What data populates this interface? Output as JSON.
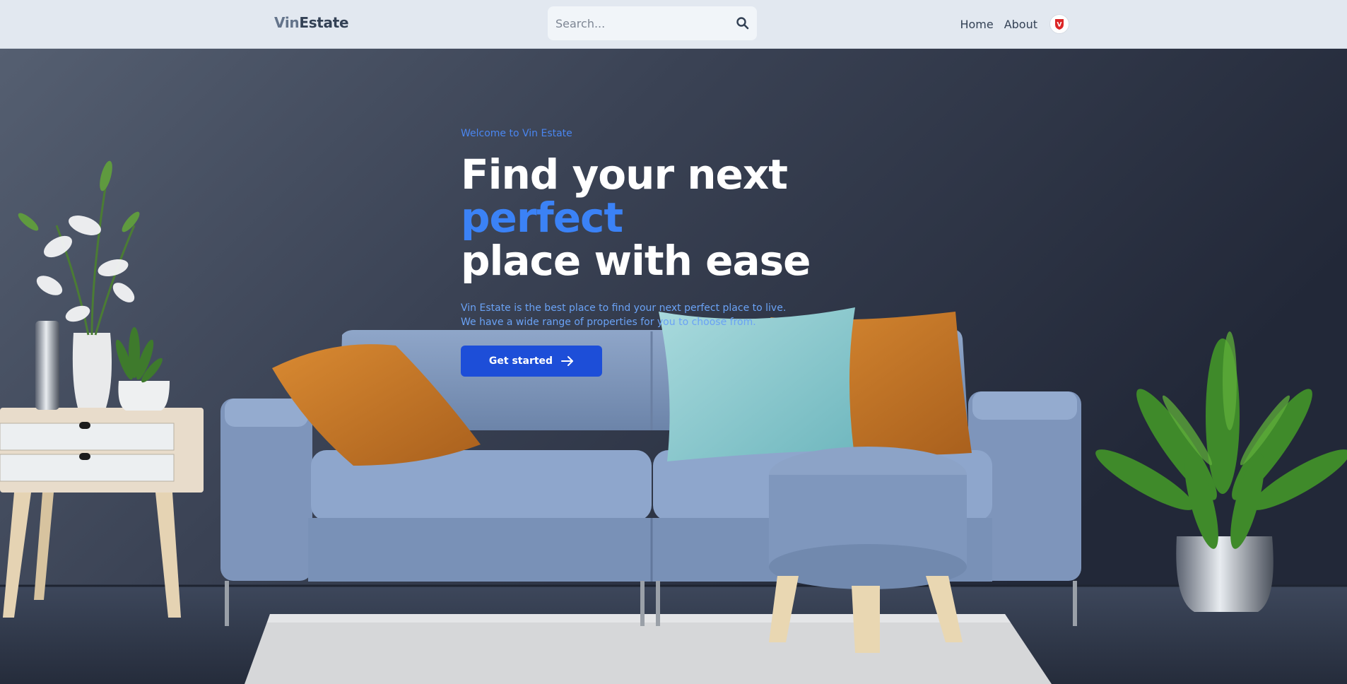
{
  "header": {
    "logo": {
      "part1": "Vin",
      "part2": "Estate"
    },
    "search": {
      "placeholder": "Search..."
    },
    "nav": [
      {
        "label": "Home"
      },
      {
        "label": "About"
      }
    ],
    "avatar_letter": "V"
  },
  "hero": {
    "eyebrow": "Welcome to Vin Estate",
    "headline": {
      "before": "Find your next ",
      "accent": "perfect",
      "after": "place with ease"
    },
    "description": {
      "line1": "Vin Estate is the best place to find your next perfect place to live.",
      "line2": "We have a wide range of properties for you to choose from."
    },
    "cta_label": "Get started"
  },
  "icons": {
    "search": "search-icon",
    "arrow": "arrow-right-icon"
  },
  "colors": {
    "header_bg": "#e2e8f0",
    "accent": "#3b82f6",
    "cta": "#1d4ed8",
    "avatar": "#dc2626"
  }
}
